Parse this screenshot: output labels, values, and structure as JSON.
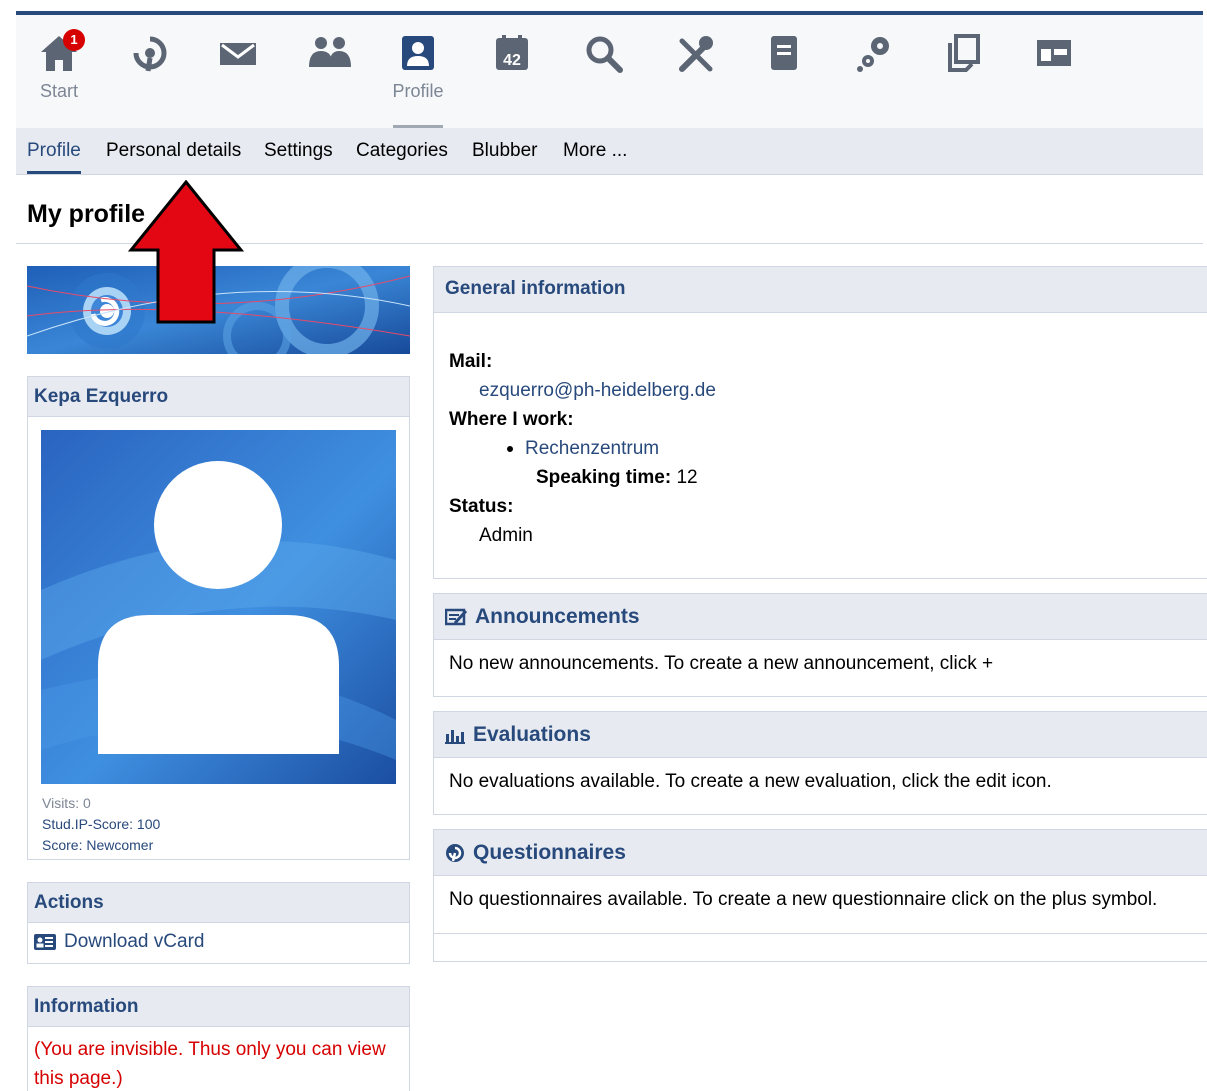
{
  "nav": {
    "start_label": "Start",
    "start_badge": "1",
    "profile_label": "Profile",
    "calendar_number": "42",
    "icons": [
      "home-icon",
      "studip-icon",
      "mail-icon",
      "community-icon",
      "profile-icon",
      "calendar-icon",
      "search-icon",
      "tools-icon",
      "files-icon",
      "settings-icon",
      "documents-icon",
      "admin-icon"
    ]
  },
  "subnav": {
    "items": [
      "Profile",
      "Personal details",
      "Settings",
      "Categories",
      "Blubber",
      "More ..."
    ],
    "active": "Profile"
  },
  "page": {
    "title": "My profile"
  },
  "user": {
    "name": "Kepa Ezquerro",
    "visits": "Visits: 0",
    "score": "Stud.IP-Score: 100",
    "rank": "Score: Newcomer"
  },
  "actions": {
    "title": "Actions",
    "download_vcard": "Download vCard"
  },
  "information": {
    "title": "Information",
    "text": "(You are invisible. Thus only you can view this page.)"
  },
  "general": {
    "title": "General information",
    "mail_label": "Mail:",
    "mail_value": "ezquerro@ph-heidelberg.de",
    "work_label": "Where I work:",
    "work_value": "Rechenzentrum",
    "speaking_label": "Speaking time:",
    "speaking_value": "12",
    "status_label": "Status:",
    "status_value": "Admin"
  },
  "announcements": {
    "title": "Announcements",
    "text": "No new announcements. To create a new announcement, click +"
  },
  "evaluations": {
    "title": "Evaluations",
    "text": "No evaluations available. To create a new evaluation, click the edit icon."
  },
  "questionnaires": {
    "title": "Questionnaires",
    "text": "No questionnaires available. To create a new questionnaire click on the plus symbol."
  },
  "colors": {
    "brand": "#28497c",
    "icon_gray": "#5b6573",
    "alert_red": "#d60000",
    "arrow_red": "#e30613"
  }
}
